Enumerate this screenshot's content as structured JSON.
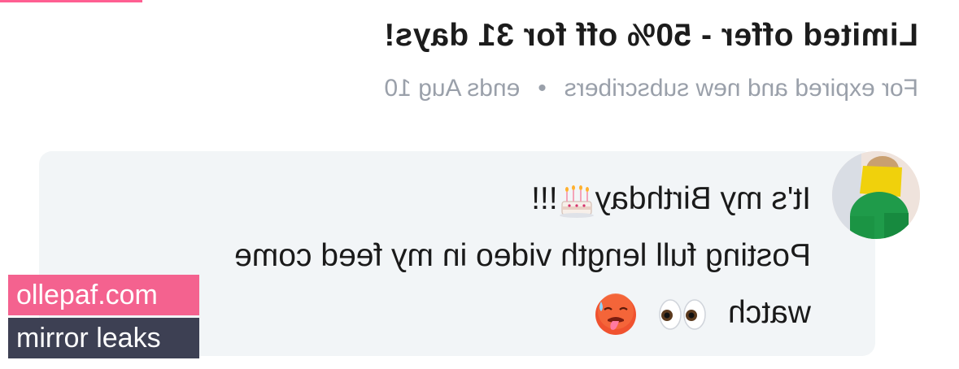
{
  "offer": {
    "title": "Limited offer - 50% off for 31 days!",
    "audience": "For expired and new subscribers",
    "ends": "ends Aug 10"
  },
  "message": {
    "line1": "It's my Birthday",
    "line1_suffix": "!!!",
    "line2": "Posting full length video in my feed come",
    "line3": "watch"
  },
  "emojis": [
    "birthday-cake",
    "eyes",
    "hot-face"
  ],
  "watermark": {
    "site": "ollepaf.com",
    "tagline": "mirror leaks"
  },
  "colors": {
    "accent": "#ff5f92",
    "watermark_pink": "#f4628f",
    "watermark_dark": "#3d4053",
    "bubble": "#f2f5f7",
    "muted_text": "#9aa0aa"
  }
}
